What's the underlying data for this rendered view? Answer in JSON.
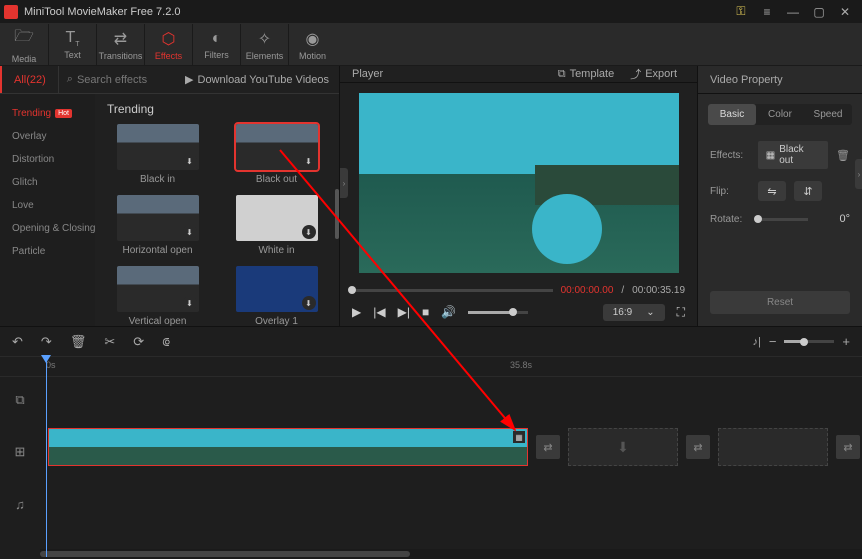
{
  "titlebar": {
    "title": "MiniTool MovieMaker Free 7.2.0"
  },
  "toolbar": {
    "tabs": [
      {
        "label": "Media",
        "icon": "🗁"
      },
      {
        "label": "Text",
        "icon": "T"
      },
      {
        "label": "Transitions",
        "icon": "⇄"
      },
      {
        "label": "Effects",
        "icon": "✦"
      },
      {
        "label": "Filters",
        "icon": "◐"
      },
      {
        "label": "Elements",
        "icon": "✧"
      },
      {
        "label": "Motion",
        "icon": "◉"
      }
    ]
  },
  "effects_panel": {
    "all_count": "All(22)",
    "search_placeholder": "Search effects",
    "download_label": "Download YouTube Videos",
    "categories": [
      "Trending",
      "Overlay",
      "Distortion",
      "Glitch",
      "Love",
      "Opening & Closing",
      "Particle"
    ],
    "grid_title": "Trending",
    "thumbs": [
      "Black in",
      "Black out",
      "Horizontal open",
      "White in",
      "Vertical open",
      "Overlay 1"
    ]
  },
  "player": {
    "title": "Player",
    "template_label": "Template",
    "export_label": "Export",
    "time_current": "00:00:00.00",
    "time_total": "00:00:35.19",
    "aspect": "16:9"
  },
  "property": {
    "title": "Video Property",
    "tabs": [
      "Basic",
      "Color",
      "Speed"
    ],
    "effects_label": "Effects:",
    "effects_value": "Black out",
    "flip_label": "Flip:",
    "rotate_label": "Rotate:",
    "rotate_value": "0°",
    "reset": "Reset"
  },
  "timeline": {
    "tick_start": "0s",
    "tick_mid": "35.8s"
  }
}
